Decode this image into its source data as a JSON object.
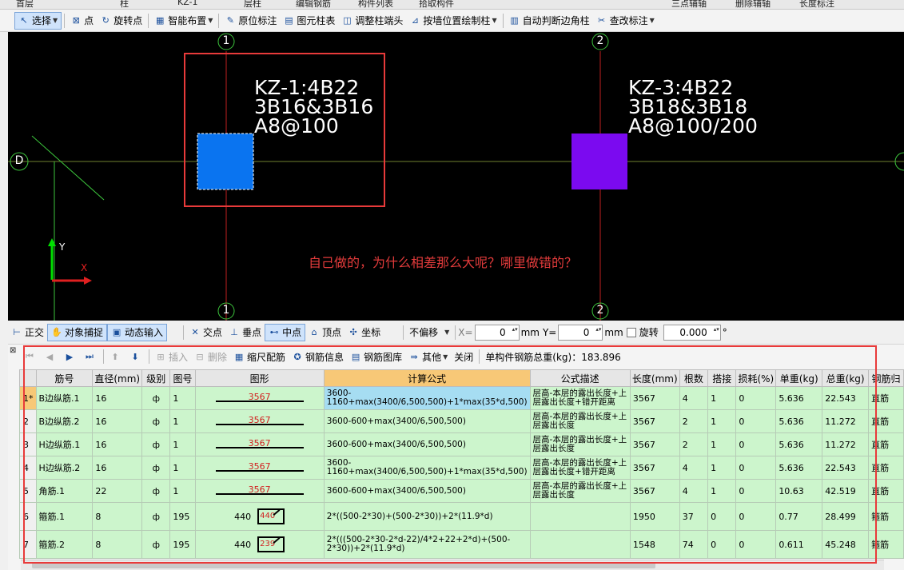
{
  "top_strip": [
    "首层",
    "柱",
    "KZ-1",
    "层柱",
    "编辑钢筋",
    "构件列表",
    "拾取构件",
    "三点辅轴",
    "删除辅轴",
    "长度标注"
  ],
  "toolbar": {
    "items": [
      {
        "label": "选择",
        "icon": "cursor-icon"
      },
      {
        "label": "点",
        "icon": "point-icon"
      },
      {
        "label": "旋转点",
        "icon": "rotate-icon"
      },
      {
        "label": "智能布置",
        "icon": "smart-layout-icon"
      },
      {
        "label": "原位标注",
        "icon": "annotate-icon"
      },
      {
        "label": "图元柱表",
        "icon": "column-table-icon"
      },
      {
        "label": "调整柱端头",
        "icon": "adjust-end-icon"
      },
      {
        "label": "按墙位置绘制柱",
        "icon": "wall-column-icon"
      },
      {
        "label": "自动判断边角柱",
        "icon": "auto-corner-icon"
      },
      {
        "label": "查改标注",
        "icon": "edit-annotation-icon"
      }
    ]
  },
  "canvas": {
    "axis_top": [
      "1",
      "2"
    ],
    "axis_bottom": [
      "1",
      "2"
    ],
    "axis_left": "D",
    "column1_label": [
      "KZ-1:4B22",
      "3B16&3B16",
      "A8@100"
    ],
    "column2_label": [
      "KZ-3:4B22",
      "3B18&3B18",
      "A8@100/200"
    ],
    "question": "自己做的，为什么相差那么大呢？哪里做错的？",
    "ucs_y": "Y",
    "ucs_x": "X",
    "colors": {
      "column1": "#0a74f0",
      "column2": "#7b0af0",
      "axis": "#3cc43c",
      "grid": "#c02020",
      "highlight": "#e83a3a"
    }
  },
  "snapbar": {
    "items": [
      {
        "label": "正交",
        "active": false,
        "icon": "ortho-icon"
      },
      {
        "label": "对象捕捉",
        "active": true,
        "icon": "snap-icon"
      },
      {
        "label": "动态输入",
        "active": true,
        "icon": "dynamic-input-icon"
      },
      {
        "label": "交点",
        "active": false,
        "icon": "intersection-icon"
      },
      {
        "label": "垂点",
        "active": false,
        "icon": "perpendicular-icon"
      },
      {
        "label": "中点",
        "active": true,
        "icon": "midpoint-icon"
      },
      {
        "label": "顶点",
        "active": false,
        "icon": "vertex-icon"
      },
      {
        "label": "坐标",
        "active": false,
        "icon": "coordinate-icon"
      }
    ],
    "offset_select": "不偏移",
    "x_label": "X=",
    "x_value": "0",
    "mm1": "mm",
    "y_label": "Y=",
    "y_value": "0",
    "mm2": "mm",
    "rotate_label": "旋转",
    "rotate_value": "0.000",
    "degree": "°"
  },
  "rebar_toolbar": {
    "items": [
      {
        "label": "插入",
        "disabled": true,
        "icon": "insert-icon"
      },
      {
        "label": "删除",
        "disabled": true,
        "icon": "delete-icon"
      },
      {
        "label": "缩尺配筋",
        "disabled": false,
        "icon": "scale-rebar-icon"
      },
      {
        "label": "钢筋信息",
        "disabled": false,
        "icon": "rebar-info-icon"
      },
      {
        "label": "钢筋图库",
        "disabled": false,
        "icon": "rebar-library-icon"
      },
      {
        "label": "其他",
        "disabled": false,
        "icon": "other-icon"
      },
      {
        "label": "关闭",
        "disabled": false,
        "icon": "close-icon"
      }
    ],
    "total_weight": "单构件钢筋总重(kg)：183.896"
  },
  "table": {
    "headers": [
      "",
      "筋号",
      "直径(mm)",
      "级别",
      "图号",
      "图形",
      "计算公式",
      "公式描述",
      "长度(mm)",
      "根数",
      "搭接",
      "损耗(%)",
      "单重(kg)",
      "总重(kg)",
      "钢筋归"
    ],
    "rows": [
      {
        "idx": "1*",
        "name": "B边纵筋.1",
        "dia": "16",
        "grade": "ф",
        "fig": "1",
        "shape": "3567",
        "formula": "3600-1160+max(3400/6,500,500)+1*max(35*d,500)",
        "desc": "层高-本层的露出长度+上层露出长度+错开距离",
        "len": "3567",
        "count": "4",
        "lap": "1",
        "loss": "0",
        "unit": "5.636",
        "total": "22.543",
        "type": "直筋",
        "selected": true
      },
      {
        "idx": "2",
        "name": "B边纵筋.2",
        "dia": "16",
        "grade": "ф",
        "fig": "1",
        "shape": "3567",
        "formula": "3600-600+max(3400/6,500,500)",
        "desc": "层高-本层的露出长度+上层露出长度",
        "len": "3567",
        "count": "2",
        "lap": "1",
        "loss": "0",
        "unit": "5.636",
        "total": "11.272",
        "type": "直筋"
      },
      {
        "idx": "3",
        "name": "H边纵筋.1",
        "dia": "16",
        "grade": "ф",
        "fig": "1",
        "shape": "3567",
        "formula": "3600-600+max(3400/6,500,500)",
        "desc": "层高-本层的露出长度+上层露出长度",
        "len": "3567",
        "count": "2",
        "lap": "1",
        "loss": "0",
        "unit": "5.636",
        "total": "11.272",
        "type": "直筋"
      },
      {
        "idx": "4",
        "name": "H边纵筋.2",
        "dia": "16",
        "grade": "ф",
        "fig": "1",
        "shape": "3567",
        "formula": "3600-1160+max(3400/6,500,500)+1*max(35*d,500)",
        "desc": "层高-本层的露出长度+上层露出长度+错开距离",
        "len": "3567",
        "count": "4",
        "lap": "1",
        "loss": "0",
        "unit": "5.636",
        "total": "22.543",
        "type": "直筋"
      },
      {
        "idx": "5",
        "name": "角筋.1",
        "dia": "22",
        "grade": "ф",
        "fig": "1",
        "shape": "3567",
        "formula": "3600-600+max(3400/6,500,500)",
        "desc": "层高-本层的露出长度+上层露出长度",
        "len": "3567",
        "count": "4",
        "lap": "1",
        "loss": "0",
        "unit": "10.63",
        "total": "42.519",
        "type": "直筋"
      },
      {
        "idx": "6",
        "name": "箍筋.1",
        "dia": "8",
        "grade": "ф",
        "fig": "195",
        "shape_left": "440",
        "shape_box": "440",
        "formula": "2*((500-2*30)+(500-2*30))+2*(11.9*d)",
        "desc": "",
        "len": "1950",
        "count": "37",
        "lap": "0",
        "loss": "0",
        "unit": "0.77",
        "total": "28.499",
        "type": "箍筋",
        "stirrup": true
      },
      {
        "idx": "7",
        "name": "箍筋.2",
        "dia": "8",
        "grade": "ф",
        "fig": "195",
        "shape_left": "440",
        "shape_box": "239",
        "formula": "2*(((500-2*30-2*d-22)/4*2+22+2*d)+(500-2*30))+2*(11.9*d)",
        "desc": "",
        "len": "1548",
        "count": "74",
        "lap": "0",
        "loss": "0",
        "unit": "0.611",
        "total": "45.248",
        "type": "箍筋",
        "stirrup": true
      }
    ]
  }
}
